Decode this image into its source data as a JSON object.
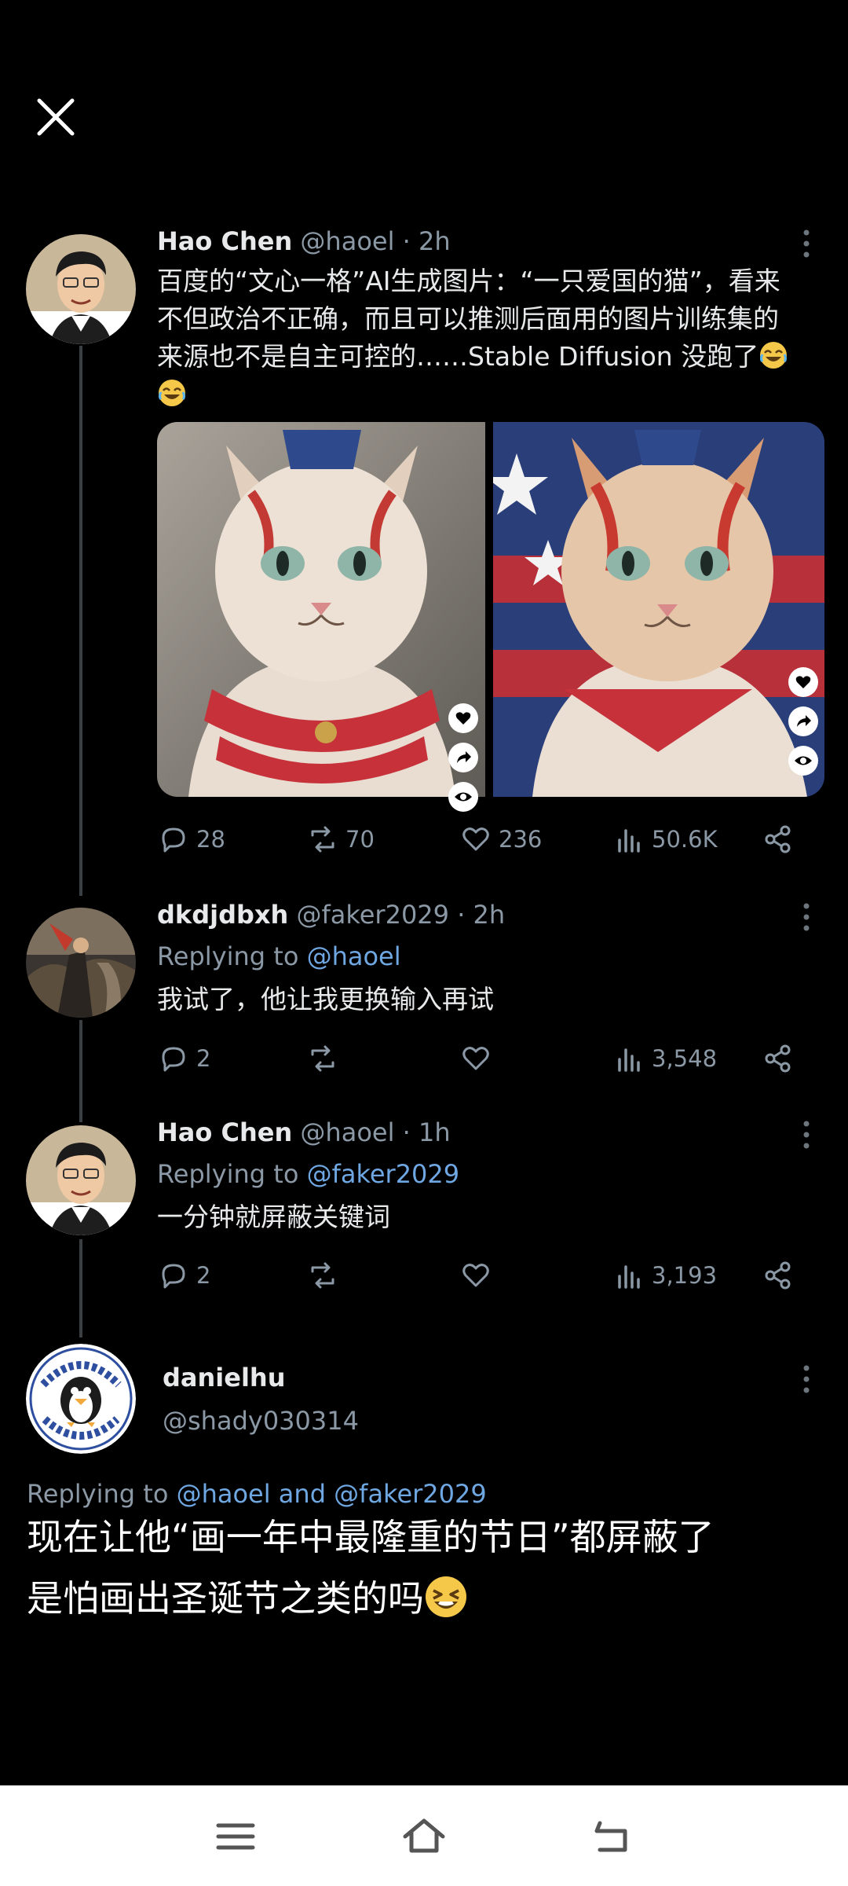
{
  "close_icon": "close-icon",
  "tweets": [
    {
      "name": "Hao Chen",
      "handle": "@haoel",
      "time": "2h",
      "text_line1": "百度的“文心一格”AI生成图片：“一只爱国的猫”，看来",
      "text_line2": "不但政治不正确，而且可以推测后面用的图片训练集的",
      "text_line3": "来源也不是自主可控的……Stable Diffusion 没跑了",
      "emoji": "laughing-tears",
      "stats": {
        "replies": "28",
        "retweets": "70",
        "likes": "236",
        "views": "50.6K"
      }
    },
    {
      "name": "dkdjdbxh",
      "handle": "@faker2029",
      "time": "2h",
      "replying_prefix": "Replying to",
      "replying_to": "@haoel",
      "text": "我试了，他让我更换输入再试",
      "stats": {
        "replies": "2",
        "views": "3,548"
      }
    },
    {
      "name": "Hao Chen",
      "handle": "@haoel",
      "time": "1h",
      "replying_prefix": "Replying to",
      "replying_to": "@faker2029",
      "text": "一分钟就屏蔽关键词",
      "stats": {
        "replies": "2",
        "views": "3,193"
      }
    }
  ],
  "focused": {
    "name": "danielhu",
    "handle": "@shady030314",
    "replying_prefix": "Replying to",
    "replying_to_1": "@haoel",
    "replying_and": "and",
    "replying_to_2": "@faker2029",
    "text_line1": "现在让他“画一年中最隆重的节日”都屏蔽了",
    "text_line2": "是怕画出圣诞节之类的吗",
    "emoji": "grinning-squint"
  },
  "dot": "·",
  "colors": {
    "background": "#000000",
    "link": "#6fa7e2",
    "muted": "#8b98a5",
    "nav_bar": "#ffffff"
  }
}
